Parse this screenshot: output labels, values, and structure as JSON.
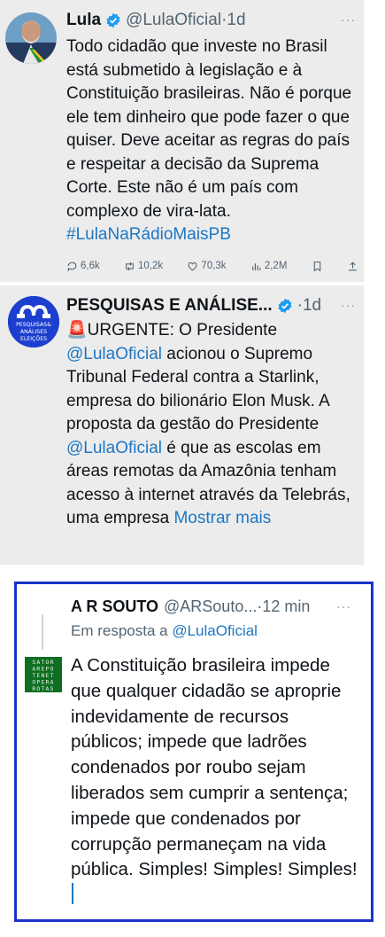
{
  "tweets": [
    {
      "name": "Lula",
      "handle": "@LulaOficial",
      "dot": "·",
      "time": "1d",
      "more": "···",
      "text": "Todo cidadão que investe no Brasil está submetido à legislação e à Constituição brasileiras. Não é porque ele tem dinheiro que pode fazer o que quiser. Deve aceitar as regras do país e respeitar a decisão da Suprema Corte. Este não é um país com complexo de vira-lata.",
      "hashtag": "#LulaNaRádioMaisPB",
      "stats": {
        "replies": "6,6k",
        "retweets": "10,2k",
        "likes": "70,3k",
        "views": "2,2M"
      }
    },
    {
      "name": "PESQUISAS E ANÁLISE...",
      "dot": "·",
      "time": "1d",
      "more": "···",
      "avatar_text": [
        "PESQUISAS&",
        "ANÁLISES",
        "ELEIÇÕES"
      ],
      "siren": "🚨",
      "text_parts": [
        "URGENTE: O Presidente ",
        "@LulaOficial",
        " acionou o Supremo Tribunal Federal contra a Starlink, empresa do bilionário Elon Musk. A proposta da gestão do Presidente ",
        "@LulaOficial",
        " é que as escolas em áreas remotas da Amazônia tenham acesso à internet através da Telebrás, uma empresa ",
        "Mostrar mais"
      ]
    }
  ],
  "reply": {
    "name": "A R SOUTO",
    "handle": "@ARSouto...",
    "dot": "·",
    "time": "12 min",
    "more": "···",
    "reply_prefix": "Em resposta a ",
    "reply_handle": "@LulaOficial",
    "avatar_grid": [
      "SATOR",
      "AREPO",
      "TENET",
      "OPERA",
      "ROTAS"
    ],
    "text": "A Constituição brasileira impede que qualquer cidadão se aproprie indevidamente de recursos públicos; impede que ladrões condenados por roubo sejam liberados sem cumprir a sentença; impede que condenados por corrupção permaneçam na vida pública. Simples! Simples! Simples!"
  },
  "colors": {
    "link": "#1d77c3",
    "verified": "#1d9bf0",
    "highlight_border": "#1a33c9",
    "tweet_bg": "#ececec"
  }
}
